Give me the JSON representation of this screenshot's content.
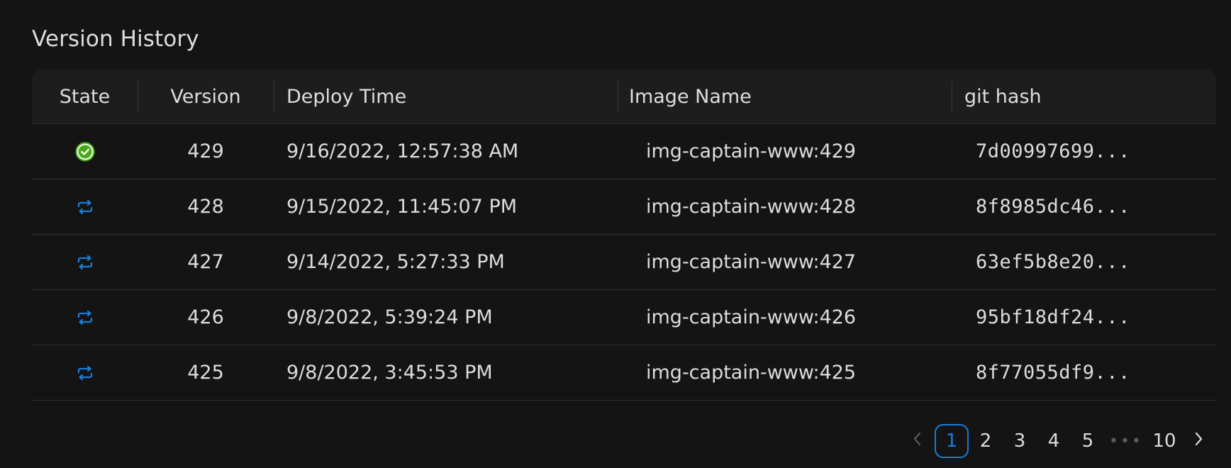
{
  "section": {
    "title": "Version History"
  },
  "table": {
    "columns": {
      "state": "State",
      "version": "Version",
      "deploy_time": "Deploy Time",
      "image_name": "Image Name",
      "git_hash": "git hash"
    },
    "rows": [
      {
        "state": "success",
        "state_icon": "check-circle-icon",
        "version": "429",
        "deploy_time": "9/16/2022, 12:57:38 AM",
        "image_name": "img-captain-www:429",
        "git_hash": "7d00997699..."
      },
      {
        "state": "revert",
        "state_icon": "retweet-icon",
        "version": "428",
        "deploy_time": "9/15/2022, 11:45:07 PM",
        "image_name": "img-captain-www:428",
        "git_hash": "8f8985dc46..."
      },
      {
        "state": "revert",
        "state_icon": "retweet-icon",
        "version": "427",
        "deploy_time": "9/14/2022, 5:27:33 PM",
        "image_name": "img-captain-www:427",
        "git_hash": "63ef5b8e20..."
      },
      {
        "state": "revert",
        "state_icon": "retweet-icon",
        "version": "426",
        "deploy_time": "9/8/2022, 5:39:24 PM",
        "image_name": "img-captain-www:426",
        "git_hash": "95bf18df24..."
      },
      {
        "state": "revert",
        "state_icon": "retweet-icon",
        "version": "425",
        "deploy_time": "9/8/2022, 3:45:53 PM",
        "image_name": "img-captain-www:425",
        "git_hash": "8f77055df9..."
      }
    ]
  },
  "pagination": {
    "prev_icon": "chevron-left-icon",
    "next_icon": "chevron-right-icon",
    "pages": [
      "1",
      "2",
      "3",
      "4",
      "5"
    ],
    "ellipsis": "•••",
    "last_page": "10",
    "current": "1"
  },
  "colors": {
    "background": "#141414",
    "header_bg": "#1d1d1d",
    "accent": "#177ddc",
    "success": "#49aa19"
  }
}
